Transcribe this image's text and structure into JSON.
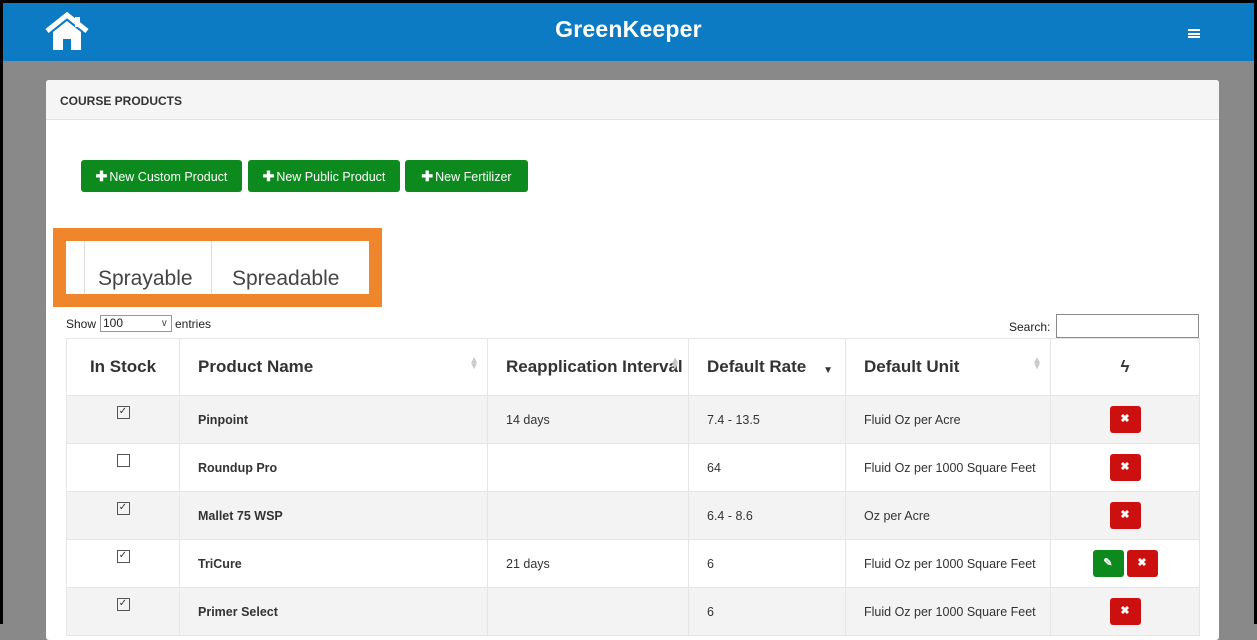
{
  "header": {
    "title": "GreenKeeper",
    "home_icon": "home-icon",
    "menu_icon": "hamburger-menu-icon"
  },
  "panel": {
    "title": "COURSE PRODUCTS",
    "buttons": {
      "new_custom": "New Custom Product",
      "new_public": "New Public Product",
      "new_fertilizer": "New Fertilizer"
    },
    "tabs": [
      "Sprayable",
      "Spreadable"
    ]
  },
  "table_controls": {
    "show_label": "Show",
    "entries_value": "100",
    "entries_label": "entries",
    "search_label": "Search:"
  },
  "table": {
    "columns": [
      "In Stock",
      "Product Name",
      "Reapplication Interval",
      "Default Rate",
      "Default Unit",
      "ϟ"
    ],
    "rows": [
      {
        "in_stock": true,
        "name": "Pinpoint",
        "interval": "14 days",
        "rate": "7.4 - 13.5",
        "unit": "Fluid Oz per Acre",
        "edit": false
      },
      {
        "in_stock": false,
        "name": "Roundup Pro",
        "interval": "",
        "rate": "64",
        "unit": "Fluid Oz per 1000 Square Feet",
        "edit": false
      },
      {
        "in_stock": true,
        "name": "Mallet 75 WSP",
        "interval": "",
        "rate": "6.4 - 8.6",
        "unit": "Oz per Acre",
        "edit": false
      },
      {
        "in_stock": true,
        "name": "TriCure",
        "interval": "21 days",
        "rate": "6",
        "unit": "Fluid Oz per 1000 Square Feet",
        "edit": true
      },
      {
        "in_stock": true,
        "name": "Primer Select",
        "interval": "",
        "rate": "6",
        "unit": "Fluid Oz per 1000 Square Feet",
        "edit": false
      }
    ]
  },
  "colors": {
    "topbar": "#0d7ac4",
    "button_green": "#0c8a1e",
    "delete_red": "#cc1010",
    "highlight_orange": "#f0862b",
    "background": "#898989"
  }
}
